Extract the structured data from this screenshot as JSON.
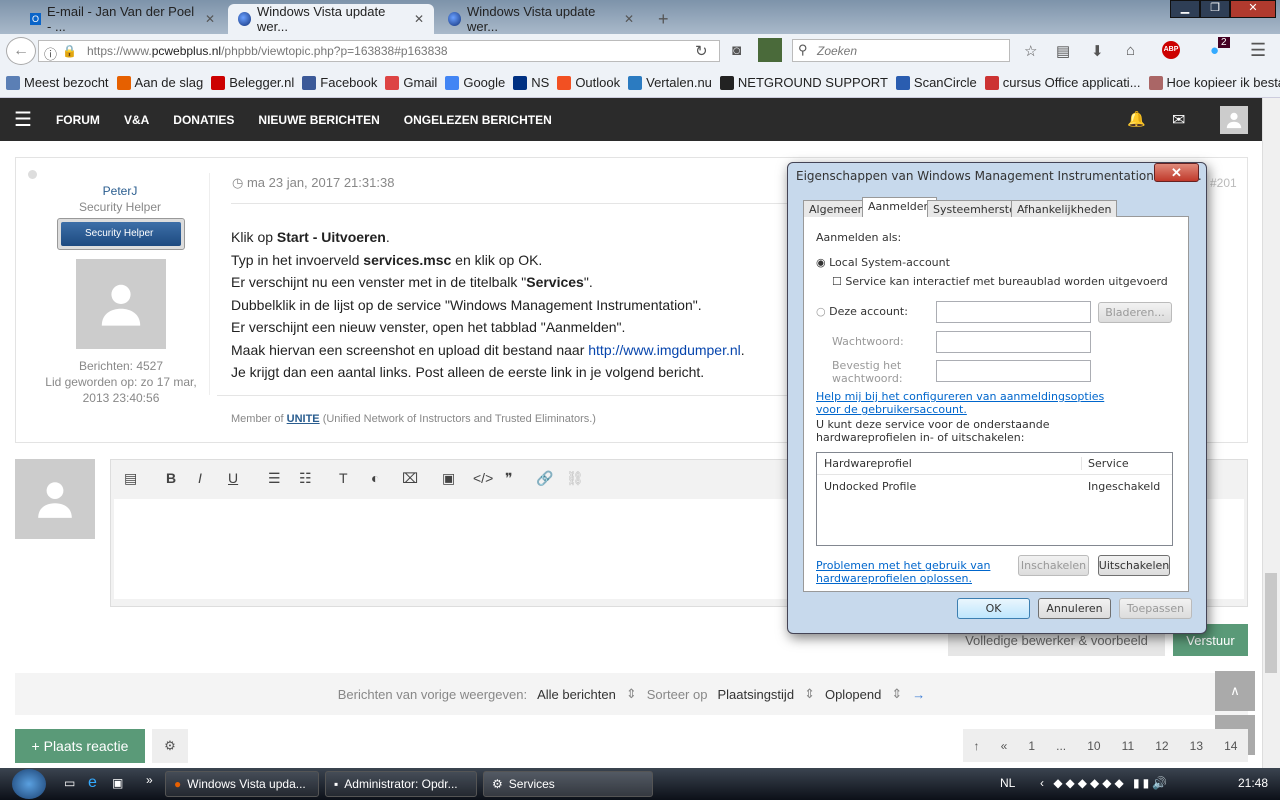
{
  "browser": {
    "tabs": [
      {
        "label": "E-mail - Jan Van der Poel - ..."
      },
      {
        "label": "Windows Vista update wer...",
        "active": true
      },
      {
        "label": "Windows Vista update wer..."
      }
    ],
    "url_prefix": "https://www.",
    "url_domain": "pcwebplus.nl",
    "url_path": "/phpbb/viewtopic.php?p=163838#p163838",
    "search_placeholder": "Zoeken",
    "badge_count": "2",
    "bookmarks": [
      "Meest bezocht",
      "Aan de slag",
      "Belegger.nl",
      "Facebook",
      "Gmail",
      "Google",
      "NS",
      "Outlook",
      "Vertalen.nu",
      "NETGROUND SUPPORT",
      "ScanCircle",
      "cursus Office applicati...",
      "Hoe kopieer ik bestan..."
    ],
    "bookmark_colors": [
      "#5b7fb5",
      "#e66000",
      "#c00",
      "#3b5998",
      "#d44",
      "#4285f4",
      "#003082",
      "#f25022",
      "#2b7bc1",
      "#222",
      "#2a5db0",
      "#c33",
      "#a66"
    ]
  },
  "forum": {
    "nav": [
      "FORUM",
      "V&A",
      "DONATIES",
      "NIEUWE BERICHTEN",
      "ONGELEZEN BERICHTEN"
    ],
    "post": {
      "author": "PeterJ",
      "rank": "Security Helper",
      "badge": "Security Helper",
      "posts": "Berichten: 4527",
      "joined": "Lid geworden op: zo 17 mar, 2013 23:40:56",
      "date": "ma 23 jan, 2017 21:31:38",
      "post_num": "#201",
      "lines": {
        "l1a": "Klik op ",
        "l1b": "Start - Uitvoeren",
        "l1c": ".",
        "l2a": "Typ in het invoerveld ",
        "l2b": "services.msc",
        "l2c": " en klik op OK.",
        "l3a": "Er verschijnt nu een venster met in de titelbalk \"",
        "l3b": "Services",
        "l3c": "\".",
        "l4": "Dubbelklik in de lijst op de service \"Windows Management Instrumentation\".",
        "l5": "Er verschijnt een nieuw venster, open het tabblad \"Aanmelden\".",
        "l6a": "Maak hiervan een screenshot en upload dit bestand naar ",
        "l6link": "http://www.imgdumper.nl",
        "l6c": ".",
        "l7": "Je krijgt dan een aantal links. Post alleen de eerste link in je volgend bericht."
      },
      "sig_a": "Member of ",
      "sig_link": "UNITE",
      "sig_b": " (Unified Network of Instructors and Trusted Eliminators.)"
    },
    "editor": {
      "full_editor": "Volledige bewerker & voorbeeld",
      "submit": "Verstuur"
    },
    "sort": {
      "label1": "Berichten van vorige weergeven:",
      "v1": "Alle berichten",
      "label2": "Sorteer op",
      "v2": "Plaatsingstijd",
      "v3": "Oplopend"
    },
    "reply": "+ Plaats reactie",
    "pager": [
      "↑",
      "«",
      "1",
      "...",
      "10",
      "11",
      "12",
      "13",
      "14"
    ]
  },
  "dialog": {
    "title": "Eigenschappen van Windows Management Instrumentation (Loka...",
    "tabs": [
      "Algemeen",
      "Aanmelden",
      "Systeemherstel",
      "Afhankelijkheden"
    ],
    "logon_as": "Aanmelden als:",
    "local": "Local System-account",
    "interact": "Service kan interactief met bureaublad worden uitgevoerd",
    "this_account": "Deze account:",
    "browse": "Bladeren...",
    "password": "Wachtwoord:",
    "confirm": "Bevestig het wachtwoord:",
    "help_link": "Help mij bij het configureren van aanmeldingsopties voor de gebruikersaccount.",
    "profiles_text": "U kunt deze service voor de onderstaande hardwareprofielen in- of uitschakelen:",
    "col_profile": "Hardwareprofiel",
    "col_service": "Service",
    "row_profile": "Undocked Profile",
    "row_service": "Ingeschakeld",
    "trouble_link": "Problemen met het gebruik van hardwareprofielen oplossen.",
    "enable": "Inschakelen",
    "disable": "Uitschakelen",
    "ok": "OK",
    "cancel": "Annuleren",
    "apply": "Toepassen"
  },
  "taskbar": {
    "items": [
      "Windows Vista upda...",
      "Administrator: Opdr...",
      "Services"
    ],
    "lang": "NL",
    "time": "21:48"
  }
}
